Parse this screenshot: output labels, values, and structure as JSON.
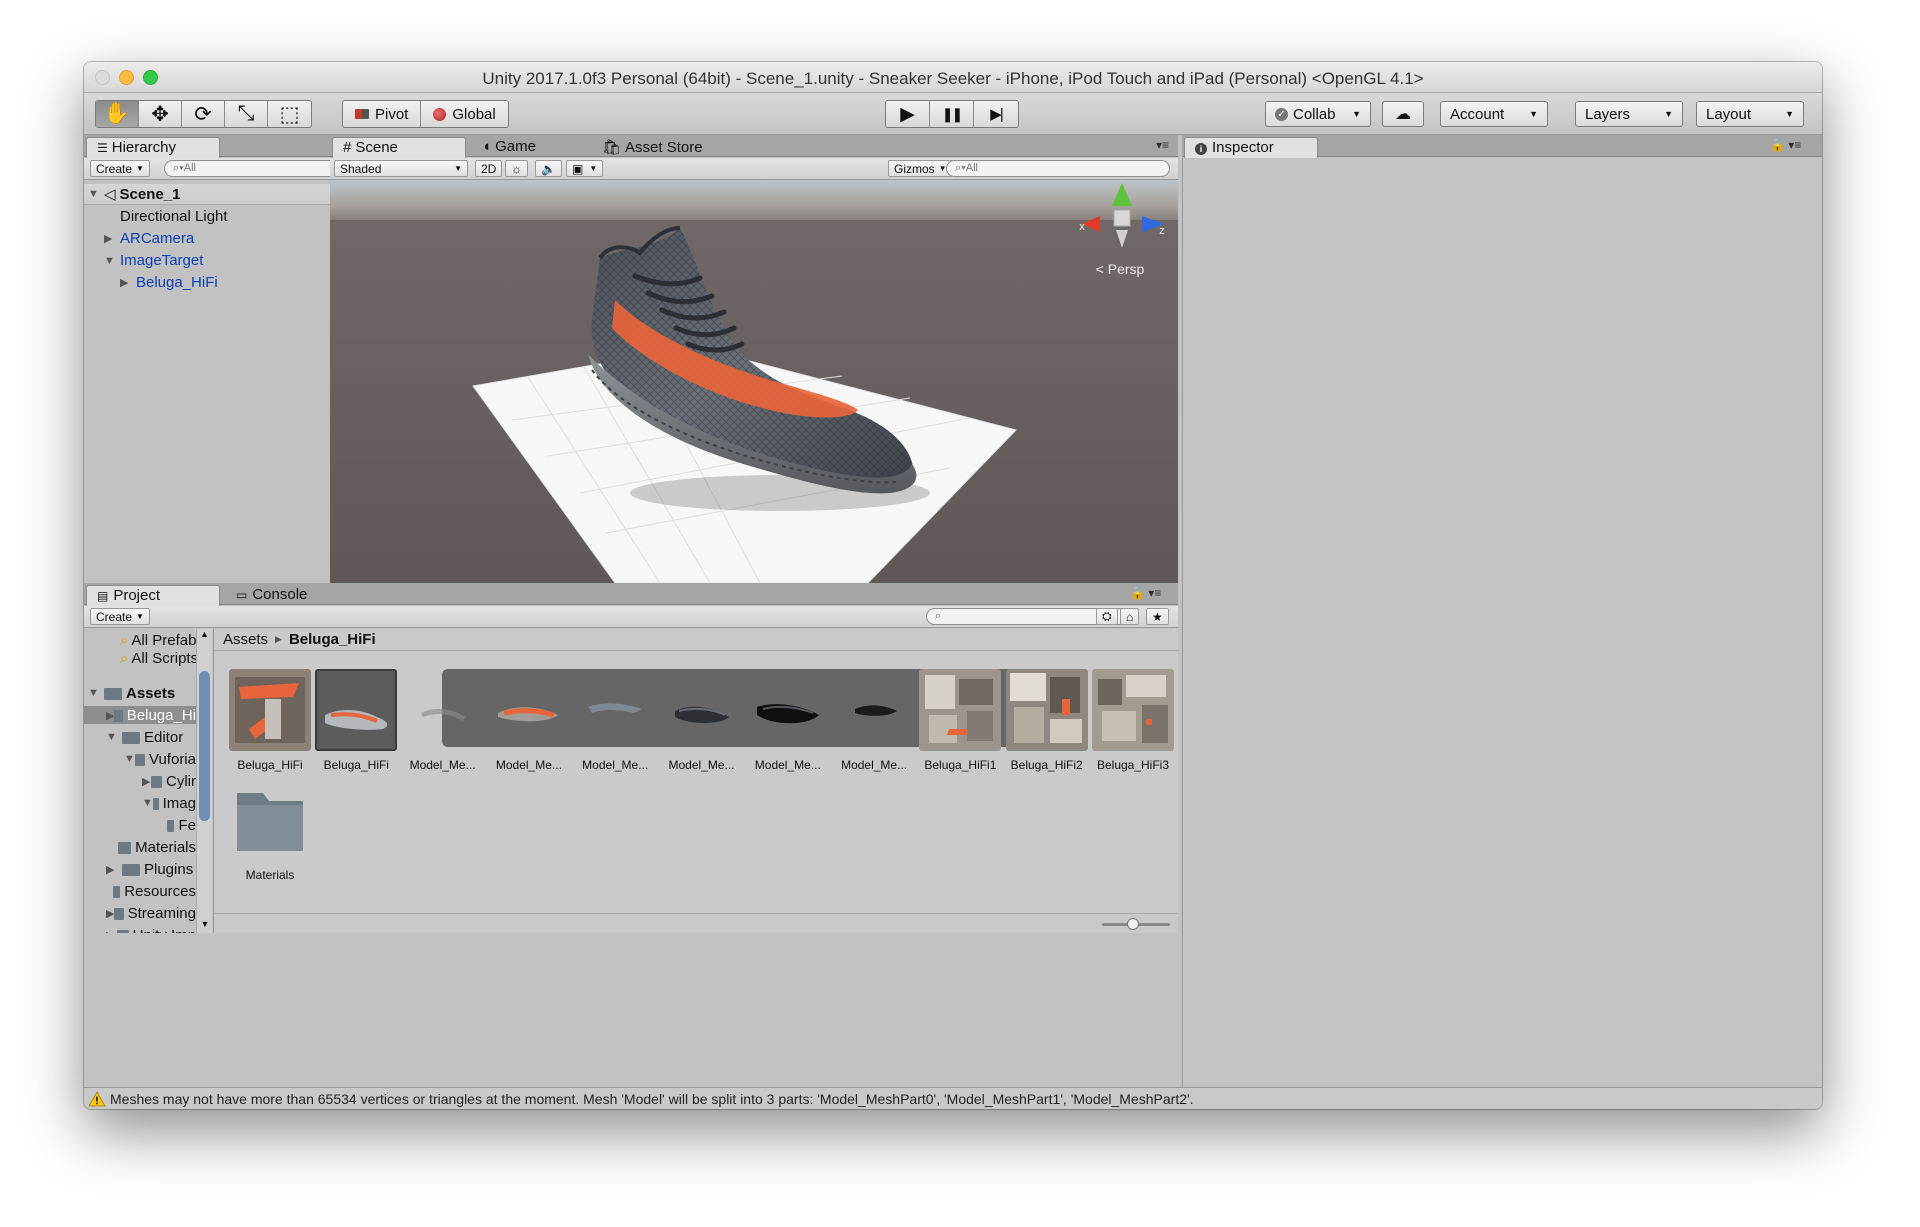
{
  "window": {
    "title": "Unity 2017.1.0f3 Personal (64bit) - Scene_1.unity - Sneaker Seeker - iPhone, iPod Touch and iPad (Personal) <OpenGL 4.1>"
  },
  "toolbar": {
    "tools": [
      {
        "name": "hand-tool",
        "glyph": "✋"
      },
      {
        "name": "move-tool",
        "glyph": "✥"
      },
      {
        "name": "rotate-tool",
        "glyph": "⟳"
      },
      {
        "name": "scale-tool",
        "glyph": "⤡"
      },
      {
        "name": "rect-tool",
        "glyph": "⬚"
      }
    ],
    "active_tool": "hand-tool",
    "pivot_label": "Pivot",
    "global_label": "Global",
    "play_glyph": "▶",
    "pause_glyph": "❚❚",
    "step_glyph": "▶|",
    "collab_label": "Collab",
    "account_label": "Account",
    "layers_label": "Layers",
    "layout_label": "Layout"
  },
  "hierarchy": {
    "tab": "Hierarchy",
    "create": "Create",
    "search_placeholder": "All",
    "scene_name": "Scene_1",
    "items": [
      {
        "label": "Directional Light",
        "indent": 1,
        "arrow": "",
        "blue": false
      },
      {
        "label": "ARCamera",
        "indent": 1,
        "arrow": "▶",
        "blue": true
      },
      {
        "label": "ImageTarget",
        "indent": 1,
        "arrow": "▼",
        "blue": true
      },
      {
        "label": "Beluga_HiFi",
        "indent": 2,
        "arrow": "▶",
        "blue": true
      }
    ]
  },
  "scene": {
    "tabs": [
      "Scene",
      "Game",
      "Asset Store"
    ],
    "shading": "Shaded",
    "mode_2d": "2D",
    "gizmos": "Gizmos",
    "search_placeholder": "All",
    "persp_label": "Persp",
    "axis_labels": {
      "x": "x",
      "y": "y",
      "z": "z"
    }
  },
  "inspector": {
    "tab": "Inspector"
  },
  "project": {
    "tabs": [
      "Project",
      "Console"
    ],
    "create": "Create",
    "favorites": [
      "All Prefab",
      "All Scripts"
    ],
    "tree": [
      {
        "label": "Assets",
        "indent": 0,
        "arrow": "▼",
        "bold": true
      },
      {
        "label": "Beluga_Hi",
        "indent": 1,
        "arrow": "▶",
        "selected": true
      },
      {
        "label": "Editor",
        "indent": 1,
        "arrow": "▼"
      },
      {
        "label": "Vuforia",
        "indent": 2,
        "arrow": "▼"
      },
      {
        "label": "Cylir",
        "indent": 3,
        "arrow": "▶"
      },
      {
        "label": "Imag",
        "indent": 3,
        "arrow": "▼"
      },
      {
        "label": "Fe",
        "indent": 4,
        "arrow": ""
      },
      {
        "label": "Materials",
        "indent": 1,
        "arrow": ""
      },
      {
        "label": "Plugins",
        "indent": 1,
        "arrow": "▶"
      },
      {
        "label": "Resources",
        "indent": 1,
        "arrow": ""
      },
      {
        "label": "Streaming",
        "indent": 1,
        "arrow": "▶"
      },
      {
        "label": "Unity Imp",
        "indent": 1,
        "arrow": "▶"
      }
    ],
    "breadcrumb": [
      "Assets",
      "Beluga_HiFi"
    ],
    "assets": [
      {
        "name": "Beluga_HiFi",
        "kind": "texture-orange"
      },
      {
        "name": "Beluga_HiFi",
        "kind": "model-prefab"
      },
      {
        "name": "Model_Me...",
        "kind": "mesh-faint"
      },
      {
        "name": "Model_Me...",
        "kind": "mesh-orange"
      },
      {
        "name": "Model_Me...",
        "kind": "mesh-thin"
      },
      {
        "name": "Model_Me...",
        "kind": "mesh-dark"
      },
      {
        "name": "Model_Me...",
        "kind": "mesh-black"
      },
      {
        "name": "Model_Me...",
        "kind": "mesh-small"
      },
      {
        "name": "Beluga_HiFi1",
        "kind": "texture-grey"
      },
      {
        "name": "Beluga_HiFi2",
        "kind": "texture-grey2"
      },
      {
        "name": "Beluga_HiFi3",
        "kind": "texture-grey3"
      },
      {
        "name": "Materials",
        "kind": "folder"
      }
    ]
  },
  "status_bar": {
    "message": "Meshes may not have more than 65534 vertices or triangles at the moment. Mesh 'Model' will be split into 3 parts: 'Model_MeshPart0', 'Model_MeshPart1', 'Model_MeshPart2'."
  },
  "colors": {
    "warning": "#f5c518",
    "accent_blue": "#0b3fb5",
    "shoe_orange": "#e8643a"
  }
}
